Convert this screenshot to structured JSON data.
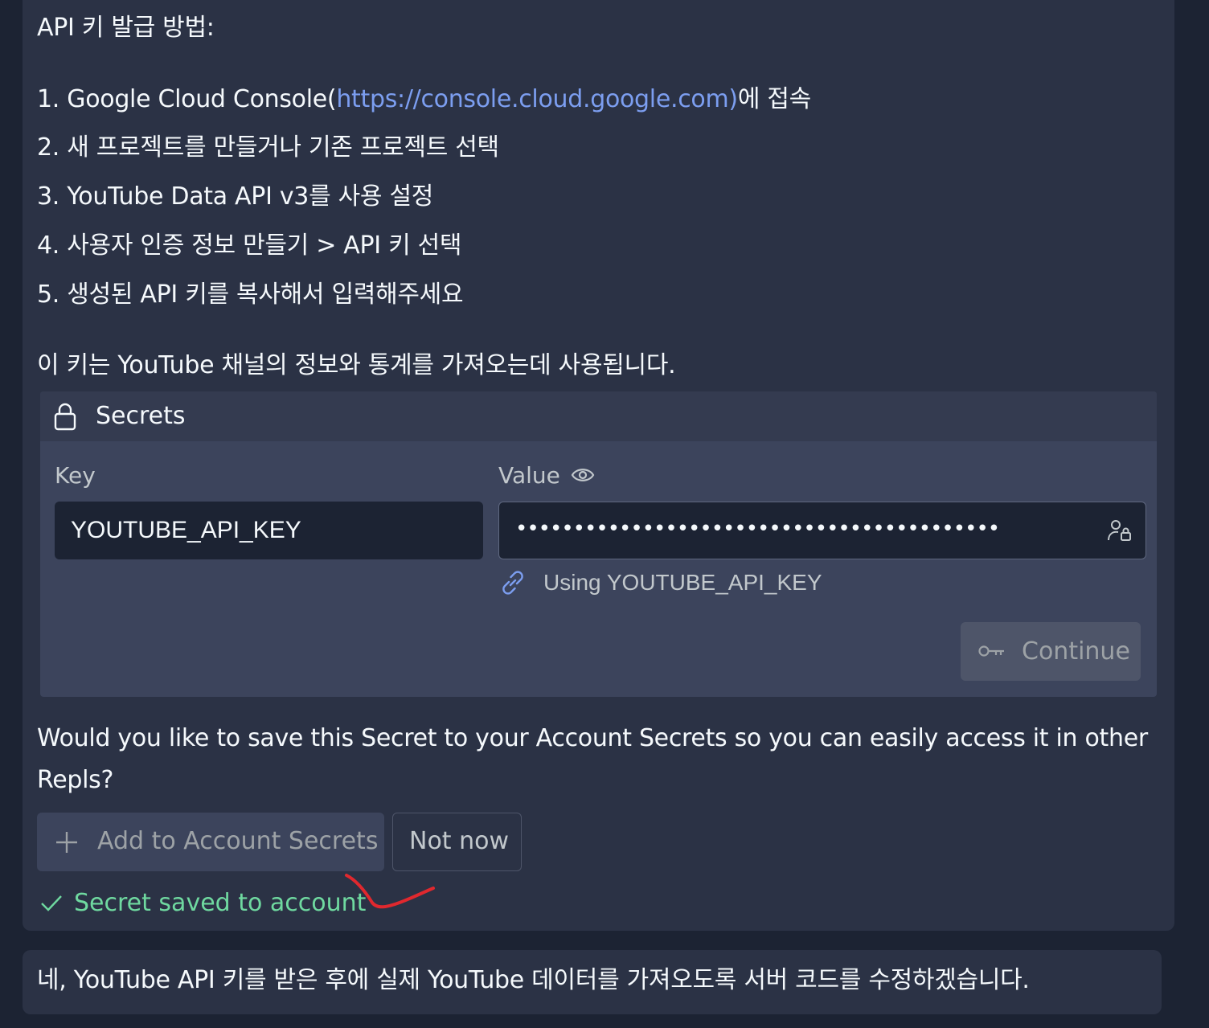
{
  "instructions": {
    "heading": "API 키 발급 방법:",
    "step1_prefix": "1. Google Cloud Console(",
    "step1_link": "https://console.cloud.google.com)",
    "step1_suffix": "에 접속",
    "step2": "2. 새 프로젝트를 만들거나 기존 프로젝트 선택",
    "step3": "3. YouTube Data API v3를 사용 설정",
    "step4": "4. 사용자 인증 정보 만들기 > API 키 선택",
    "step5": "5. 생성된 API 키를 복사해서 입력해주세요",
    "note": "이 키는 YouTube 채널의 정보와 통계를 가져오는데 사용됩니다."
  },
  "secrets": {
    "title": "Secrets",
    "key_label": "Key",
    "value_label": "Value",
    "key_value": "YOUTUBE_API_KEY",
    "value_masked": "••••••••••••••••••••••••••••••••••••••••••",
    "using_text": "Using YOUTUBE_API_KEY",
    "continue_label": "Continue"
  },
  "prompt": {
    "question": "Would you like to save this Secret to your Account Secrets so you can easily access it in other Repls?",
    "add_button": "Add to Account Secrets",
    "not_now_button": "Not now",
    "saved_status": "Secret saved to account"
  },
  "reply": {
    "text": "네, YouTube API 키를 받은 후에 실제 YouTube 데이터를 가져오도록 서버 코드를 수정하겠습니다."
  },
  "colors": {
    "background": "#1c2333",
    "message_bg": "#2b3245",
    "card_bg": "#3c445c",
    "link": "#7c9ef0",
    "success": "#6fd9a0",
    "annotation": "#e0282e"
  },
  "icons": [
    "lock-icon",
    "eye-icon",
    "account-key-icon",
    "link-icon",
    "key-icon",
    "plus-icon",
    "check-icon"
  ]
}
